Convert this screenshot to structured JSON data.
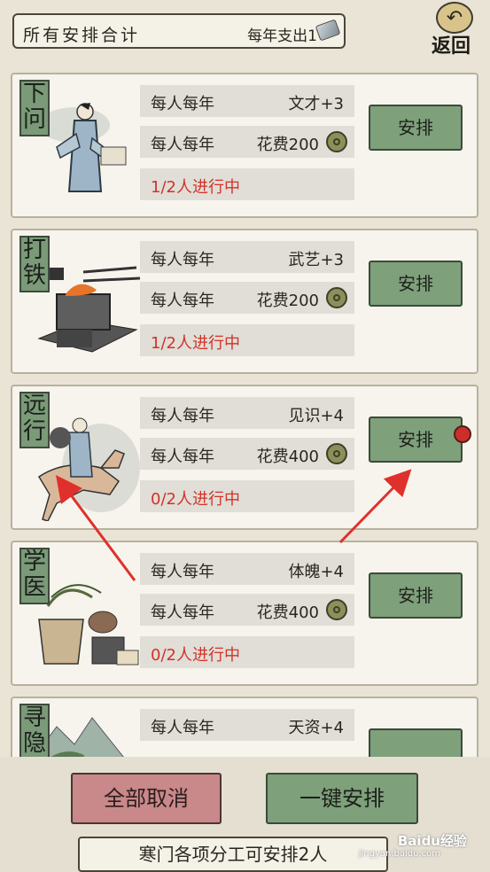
{
  "header": {
    "title": "所有安排合计",
    "yearly_expense": "每年支出1",
    "back_label": "返回",
    "back_icon": "undo-arrow-icon"
  },
  "cards": [
    {
      "name": "下问",
      "line1_left": "每人每年",
      "line1_right": "文才+3",
      "line2_left": "每人每年",
      "line2_right": "花费200",
      "status": "1/2人进行中",
      "button": "安排",
      "has_dot": false
    },
    {
      "name": "打铁",
      "line1_left": "每人每年",
      "line1_right": "武艺+3",
      "line2_left": "每人每年",
      "line2_right": "花费200",
      "status": "1/2人进行中",
      "button": "安排",
      "has_dot": false
    },
    {
      "name": "远行",
      "line1_left": "每人每年",
      "line1_right": "见识+4",
      "line2_left": "每人每年",
      "line2_right": "花费400",
      "status": "0/2人进行中",
      "button": "安排",
      "has_dot": true
    },
    {
      "name": "学医",
      "line1_left": "每人每年",
      "line1_right": "体魄+4",
      "line2_left": "每人每年",
      "line2_right": "花费400",
      "status": "0/2人进行中",
      "button": "安排",
      "has_dot": false
    },
    {
      "name": "寻隐",
      "line1_left": "每人每年",
      "line1_right": "天资+4",
      "line2_left": "",
      "line2_right": "",
      "status": "",
      "button": "",
      "has_dot": false
    }
  ],
  "footer": {
    "cancel_all": "全部取消",
    "one_key": "一键安排",
    "note": "寒门各项分工可安排2人"
  },
  "watermark": {
    "brand": "Baidu经验",
    "url": "jingyan.baidu.com"
  },
  "colors": {
    "status_red": "#d33128",
    "button_green": "#7ea07b",
    "cancel_red": "#c9888a",
    "annotation_arrow": "#e0302c"
  }
}
